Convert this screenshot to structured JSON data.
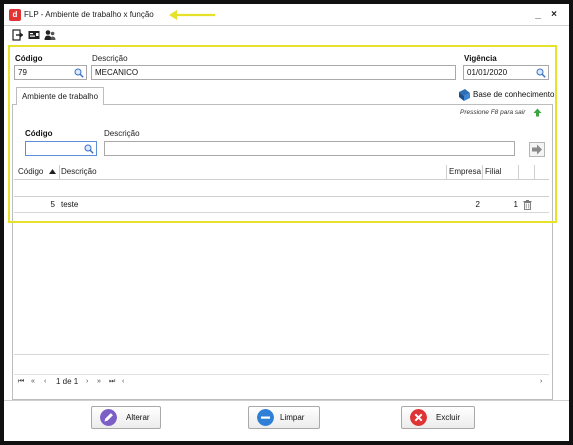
{
  "window": {
    "title": "FLP - Ambiente de trabalho x função",
    "minimize_glyph": "_",
    "close_glyph": "×"
  },
  "toolbar": {
    "icons": [
      "exit-icon",
      "card-icon",
      "users-icon"
    ]
  },
  "header_form": {
    "codigo_label": "Código",
    "codigo_value": "79",
    "descricao_label": "Descrição",
    "descricao_value": "MECANICO",
    "vigencia_label": "Vigência",
    "vigencia_value": "01/01/2020"
  },
  "tabs": [
    {
      "label": "Ambiente de trabalho"
    }
  ],
  "knowledge_base": {
    "label": "Base de conhecimento"
  },
  "hint": "Pressione F8 para sair",
  "filter": {
    "codigo_label": "Código",
    "codigo_value": "",
    "descricao_label": "Descrição",
    "descricao_value": ""
  },
  "grid": {
    "columns": [
      "Código",
      "Descrição",
      "Empresa",
      "Filial"
    ],
    "rows": [
      {
        "codigo": "5",
        "descricao": "teste",
        "empresa": "2",
        "filial": "1"
      }
    ]
  },
  "pager": {
    "page_text": "1 de 1"
  },
  "actions": {
    "alterar": "Alterar",
    "limpar": "Limpar",
    "excluir": "Excluir"
  },
  "colors": {
    "highlight": "#e6e22a",
    "alterar_icon": "#7b5fc7",
    "limpar_icon": "#2f7fd6",
    "excluir_icon": "#e03434"
  }
}
